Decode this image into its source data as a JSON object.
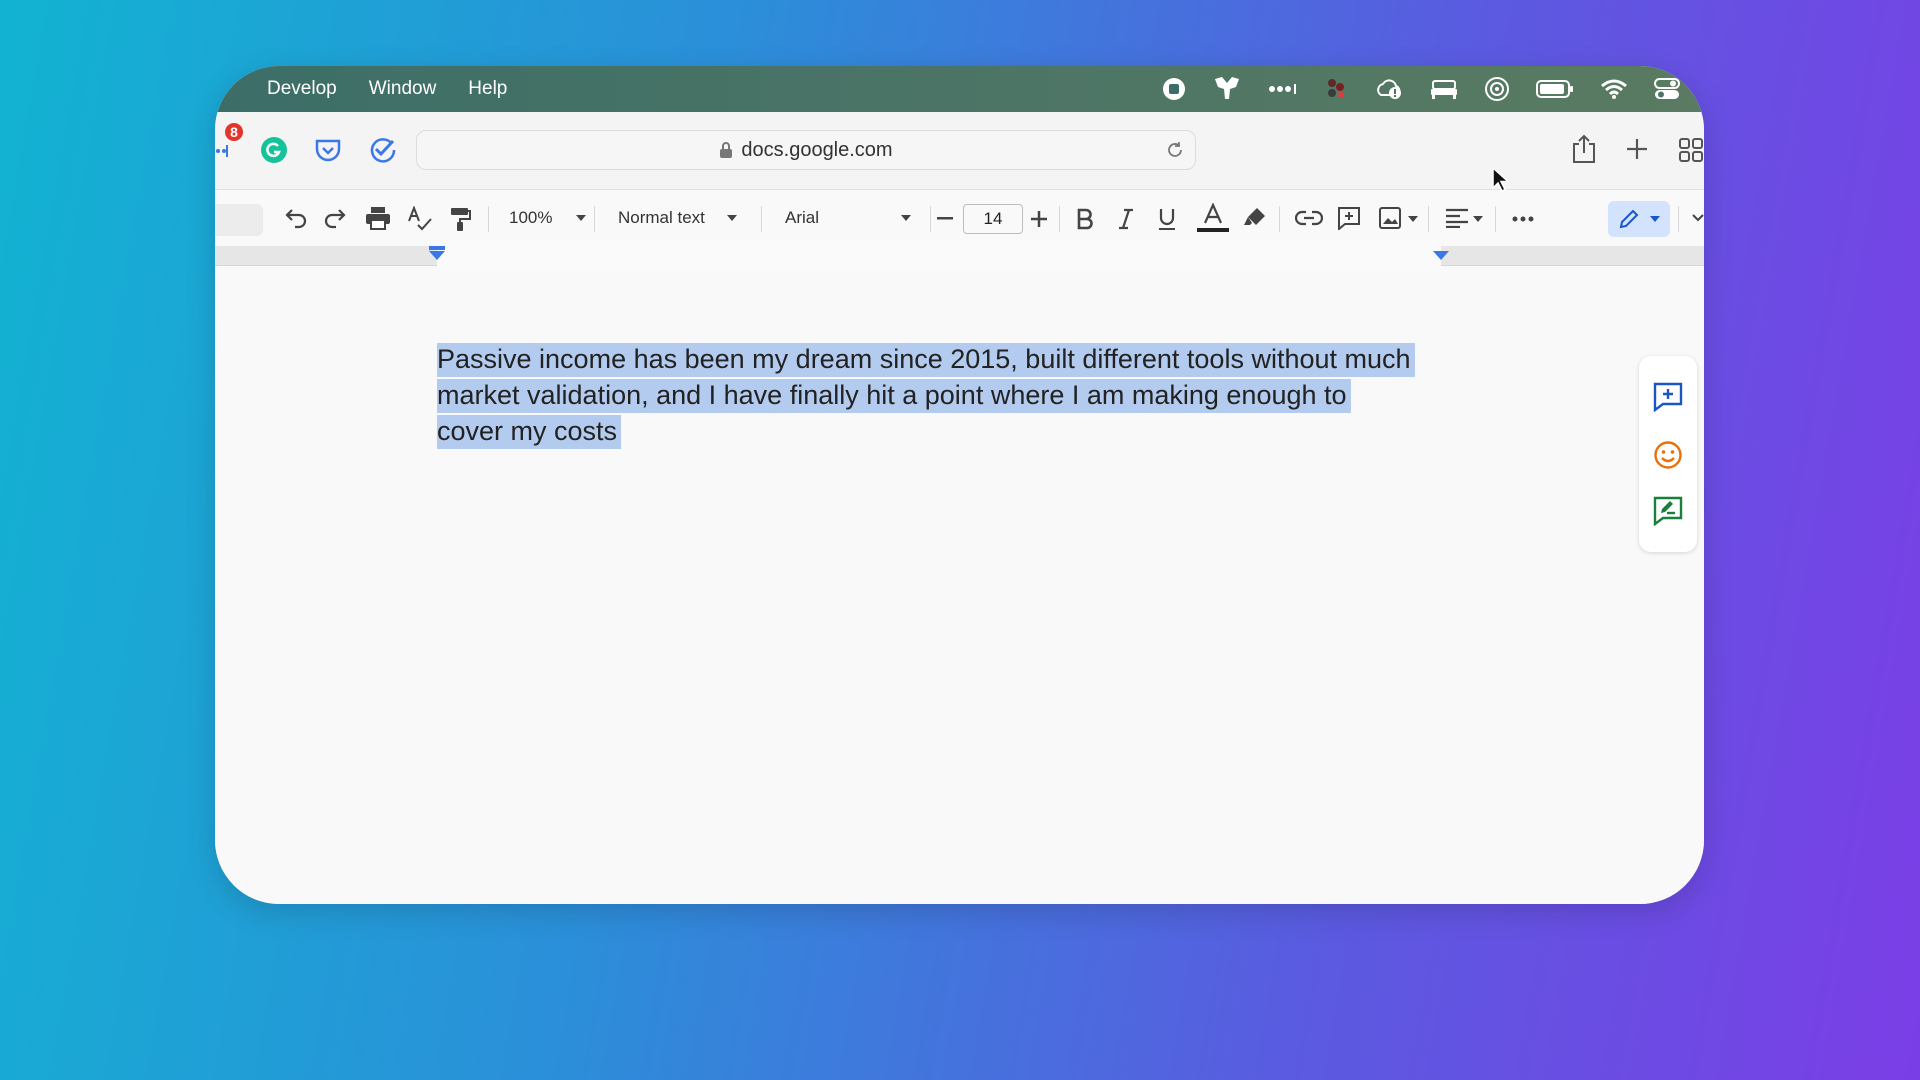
{
  "menubar": {
    "menus": [
      "Develop",
      "Window",
      "Help"
    ]
  },
  "browser": {
    "url": "docs.google.com",
    "extension_badge": "8"
  },
  "docs_toolbar": {
    "zoom": "100%",
    "style": "Normal text",
    "font": "Arial",
    "font_size": "14"
  },
  "document": {
    "text": "Passive income has been my dream since 2015, built different tools without much market validation, and I have finally hit a point where I am making enough to cover my costs",
    "lines": [
      "Passive income has been my dream since 2015, built different tools without much",
      "market validation, and I have finally hit a point where I am making enough to",
      "cover my costs"
    ],
    "selected": true
  },
  "colors": {
    "selection": "#b3cbef",
    "accent_blue": "#3b78e7",
    "emoji_orange": "#e8710a",
    "suggest_green": "#188038"
  }
}
